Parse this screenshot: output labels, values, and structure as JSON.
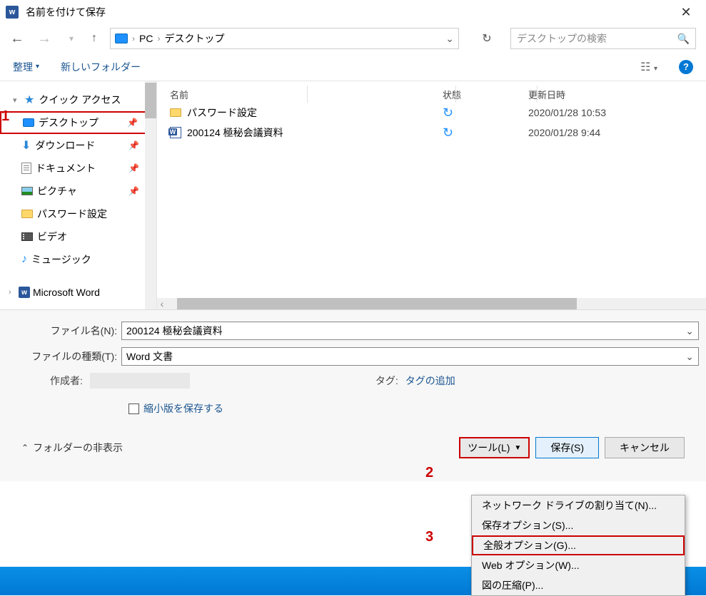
{
  "title": "名前を付けて保存",
  "breadcrumb": {
    "pc": "PC",
    "desktop": "デスクトップ"
  },
  "search_placeholder": "デスクトップの検索",
  "toolbar": {
    "organize": "整理",
    "newfolder": "新しいフォルダー"
  },
  "tree": {
    "quick": "クイック アクセス",
    "desktop": "デスクトップ",
    "downloads": "ダウンロード",
    "documents": "ドキュメント",
    "pictures": "ピクチャ",
    "pwfolder": "パスワード設定",
    "videos": "ビデオ",
    "music": "ミュージック",
    "word": "Microsoft Word"
  },
  "columns": {
    "name": "名前",
    "status": "状態",
    "modified": "更新日時"
  },
  "files": [
    {
      "name": "パスワード設定",
      "date": "2020/01/28 10:53",
      "kind": "folder"
    },
    {
      "name": "200124 極秘会議資料",
      "date": "2020/01/28 9:44",
      "kind": "word"
    }
  ],
  "form": {
    "filename_label": "ファイル名(N):",
    "filename_value": "200124 極秘会議資料",
    "filetype_label": "ファイルの種類(T):",
    "filetype_value": "Word 文書",
    "author_label": "作成者:",
    "tag_label": "タグ:",
    "tag_value": "タグの追加",
    "thumbnail_label": "縮小版を保存する"
  },
  "footer": {
    "hide": "フォルダーの非表示",
    "tools": "ツール(L)",
    "save": "保存(S)",
    "cancel": "キャンセル"
  },
  "tools_menu": {
    "map_drive": "ネットワーク ドライブの割り当て(N)...",
    "save_options": "保存オプション(S)...",
    "general_options": "全般オプション(G)...",
    "web_options": "Web オプション(W)...",
    "compress": "図の圧縮(P)..."
  },
  "annotations": {
    "a1": "1",
    "a2": "2",
    "a3": "3"
  }
}
